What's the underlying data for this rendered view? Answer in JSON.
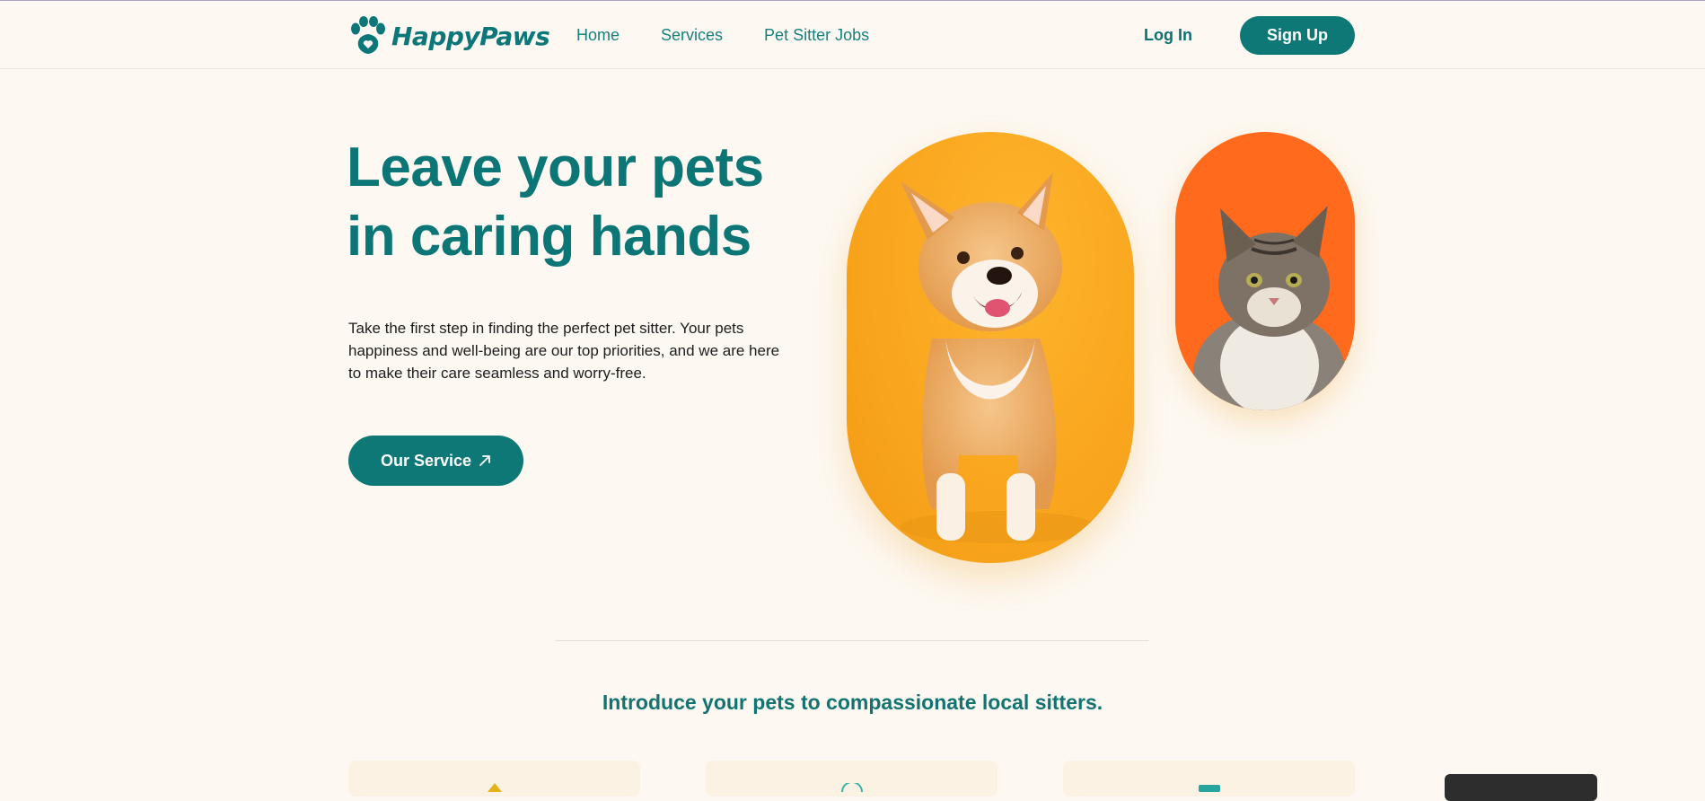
{
  "brand": {
    "name": "HappyPaws",
    "accent": "#0d7875",
    "background": "#fdf8f1"
  },
  "nav": {
    "items": [
      {
        "label": "Home"
      },
      {
        "label": "Services"
      },
      {
        "label": "Pet Sitter Jobs"
      }
    ],
    "login_label": "Log In",
    "signup_label": "Sign Up"
  },
  "hero": {
    "title_line1": "Leave your pets",
    "title_line2": "in caring hands",
    "description": "Take the first step in finding the perfect pet sitter. Your pets happiness and well-being are our top priorities, and we are here to make their care seamless and worry-free.",
    "cta_label": "Our Service",
    "cta_icon": "arrow-up-right-icon",
    "images": [
      {
        "name": "corgi-photo",
        "bg": "#f9a51d"
      },
      {
        "name": "cat-photo",
        "bg": "#ff6a1c"
      }
    ]
  },
  "section": {
    "title": "Introduce your pets to compassionate local sitters.",
    "cards": [
      {
        "icon": "diamond-icon",
        "icon_color": "#e3b21a"
      },
      {
        "icon": "circle-icon",
        "icon_color": "#39b3a8"
      },
      {
        "icon": "square-icon",
        "icon_color": "#26a5a0"
      }
    ]
  }
}
